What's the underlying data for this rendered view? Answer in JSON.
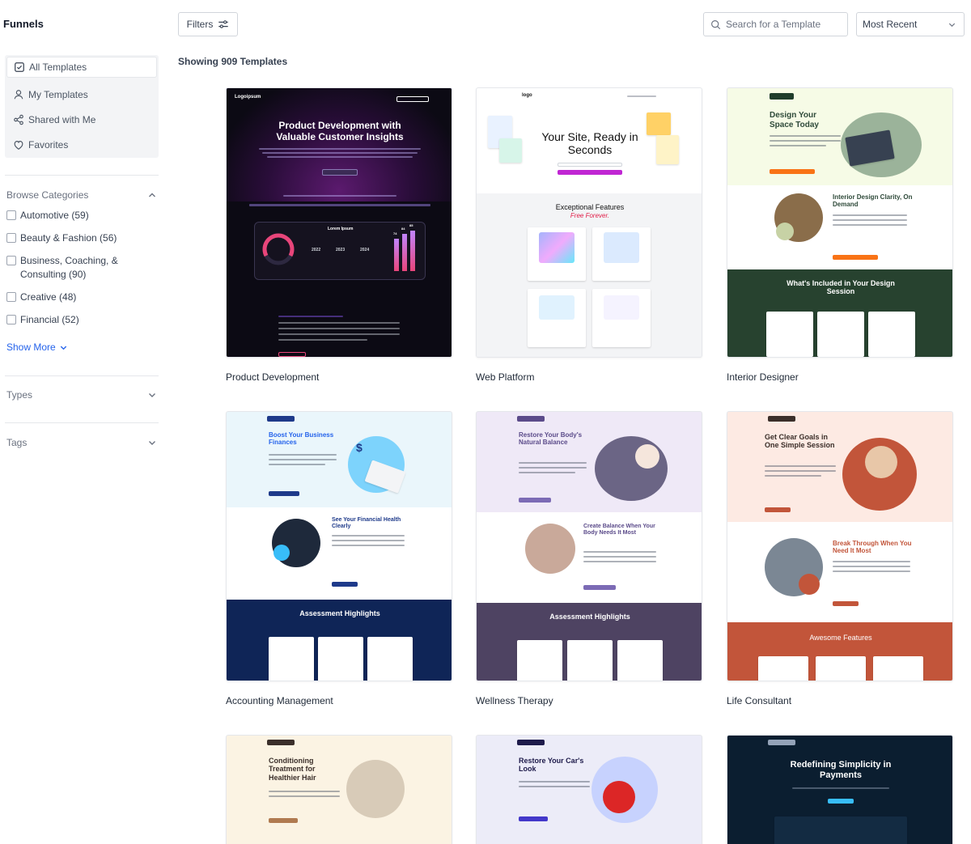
{
  "sidebar": {
    "title": "Funnels",
    "nav": [
      {
        "label": "All Templates",
        "icon": "checkbox-icon",
        "active": true
      },
      {
        "label": "My Templates",
        "icon": "user-icon"
      },
      {
        "label": "Shared with Me",
        "icon": "share-icon"
      },
      {
        "label": "Favorites",
        "icon": "heart-icon"
      }
    ],
    "browse_label": "Browse Categories",
    "categories": [
      {
        "label": "Automotive (59)"
      },
      {
        "label": "Beauty & Fashion (56)"
      },
      {
        "label": "Business, Coaching, & Consulting (90)"
      },
      {
        "label": "Creative (48)"
      },
      {
        "label": "Financial (52)"
      }
    ],
    "show_more": "Show More",
    "types_label": "Types",
    "tags_label": "Tags"
  },
  "toolbar": {
    "filters_label": "Filters",
    "search_placeholder": "Search for a Template",
    "sort_value": "Most Recent"
  },
  "results": {
    "count_text": "Showing 909 Templates"
  },
  "templates": [
    {
      "name": "Product Development",
      "preview": {
        "headline": "Product Development with Valuable Customer Insights",
        "logo": "Logoipsum",
        "chart_label": "Lorem Ipsum",
        "years": [
          "2022",
          "2023",
          "2024"
        ],
        "bars": [
          "74",
          "84",
          "85"
        ]
      }
    },
    {
      "name": "Web Platform",
      "preview": {
        "logo": "logo",
        "headline": "Your Site, Ready in Seconds",
        "features_title": "Exceptional Features",
        "features_sub": "Free Forever."
      }
    },
    {
      "name": "Interior Designer",
      "preview": {
        "headline": "Design Your Space Today",
        "subhead": "Interior Design Clarity, On Demand",
        "section": "What's Included in Your Design Session"
      }
    },
    {
      "name": "Accounting Management",
      "preview": {
        "headline": "Boost Your Business Finances",
        "subhead": "See Your Financial Health Clearly",
        "section": "Assessment Highlights"
      }
    },
    {
      "name": "Wellness Therapy",
      "preview": {
        "headline": "Restore Your Body's Natural Balance",
        "subhead": "Create Balance When Your Body Needs It Most",
        "section": "Assessment Highlights"
      }
    },
    {
      "name": "Life Consultant",
      "preview": {
        "headline": "Get Clear Goals in One Simple Session",
        "subhead": "Break Through When You Need It Most",
        "section": "Awesome Features"
      }
    },
    {
      "name": "",
      "preview": {
        "headline": "Conditioning Treatment for Healthier Hair"
      }
    },
    {
      "name": "",
      "preview": {
        "headline": "Restore Your Car's Look"
      }
    },
    {
      "name": "",
      "preview": {
        "headline": "Redefining Simplicity in Payments"
      }
    }
  ],
  "colors": {
    "accent": "#2563eb",
    "border": "#d1d5db",
    "sidebar_bg": "#f3f4f6"
  }
}
